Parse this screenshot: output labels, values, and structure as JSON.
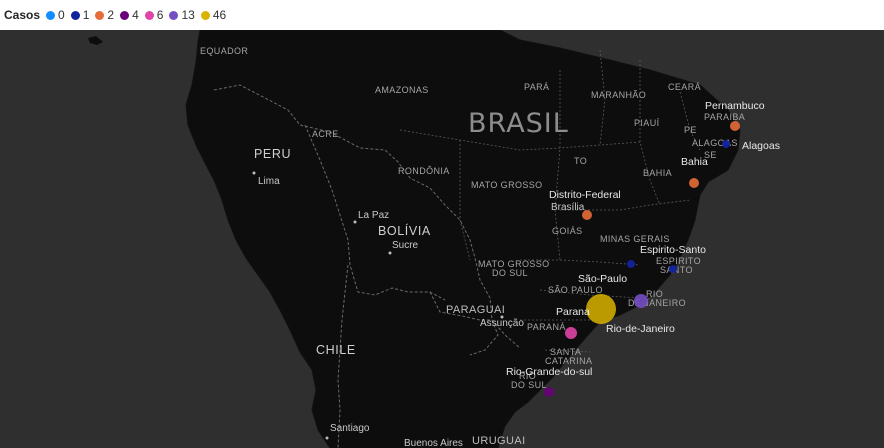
{
  "legend": {
    "title": "Casos",
    "items": [
      {
        "label": "0",
        "color": "#118dff"
      },
      {
        "label": "1",
        "color": "#12239e"
      },
      {
        "label": "2",
        "color": "#e66c37"
      },
      {
        "label": "4",
        "color": "#6b007b"
      },
      {
        "label": "6",
        "color": "#e044a7"
      },
      {
        "label": "13",
        "color": "#744ec2"
      },
      {
        "label": "46",
        "color": "#d9b300"
      }
    ]
  },
  "map_labels": {
    "equador": "EQUADOR",
    "amazonas": "AMAZONAS",
    "para": "PARÁ",
    "maranhao": "MARANHÃO",
    "ceara": "CEARÁ",
    "brasil": "BRASIL",
    "peru": "PERU",
    "lima": "Lima",
    "acre": "ACRE",
    "piaui": "PIAUÍ",
    "pe": "PE",
    "paraiba": "PARAIBA",
    "alagoas_region": "ALAGOAS",
    "se": "SE",
    "rondonia": "RONDÔNIA",
    "to": "TO",
    "mato_grosso": "MATO GROSSO",
    "bahia_region": "BAHIA",
    "la_paz": "La Paz",
    "bolivia": "BOLÍVIA",
    "sucre": "Sucre",
    "brasilia": "Brasília",
    "goias": "GOIÁS",
    "minas_gerais": "MINAS GERAIS",
    "mato_grosso_do_sul_1": "MATO GROSSO",
    "mato_grosso_do_sul_2": "DO SUL",
    "espirito_santo_1": "ESPIRITO",
    "espirito_santo_2": "SANTO",
    "sao_paulo_region": "SÃO PAULO",
    "rio_1": "RIO",
    "rio_2": "DE JANEIRO",
    "paraguai": "PARAGUAI",
    "assuncao": "Assunção",
    "parana_region": "PARANÁ",
    "chile": "CHILE",
    "santa_catarina_1": "SANTA",
    "santa_catarina_2": "CATARINA",
    "rgs_1": "RIO",
    "rgs_2": "DO SUL",
    "santiago": "Santiago",
    "buenos_aires": "Buenos Aires",
    "uruguai": "URUGUAI"
  },
  "bubbles": [
    {
      "label": "Pernambuco",
      "casos": 2,
      "color": "#e66c37"
    },
    {
      "label": "Alagoas",
      "casos": 1,
      "color": "#12239e"
    },
    {
      "label": "Bahia",
      "casos": 2,
      "color": "#e66c37"
    },
    {
      "label": "Distrito-Federal",
      "casos": 2,
      "color": "#e66c37"
    },
    {
      "label": "Espirito-Santo",
      "casos": 1,
      "color": "#12239e"
    },
    {
      "label": "São-Paulo",
      "casos": 1,
      "color": "#12239e"
    },
    {
      "label": "Parana",
      "casos": 46,
      "color": "#d9b300"
    },
    {
      "label": "Rio-de-Janeiro",
      "casos": 13,
      "color": "#744ec2"
    },
    {
      "label": "Rio-Grande-do-sul",
      "casos": 4,
      "color": "#6b007b"
    },
    {
      "label": "",
      "casos": 6,
      "color": "#e044a7"
    }
  ]
}
